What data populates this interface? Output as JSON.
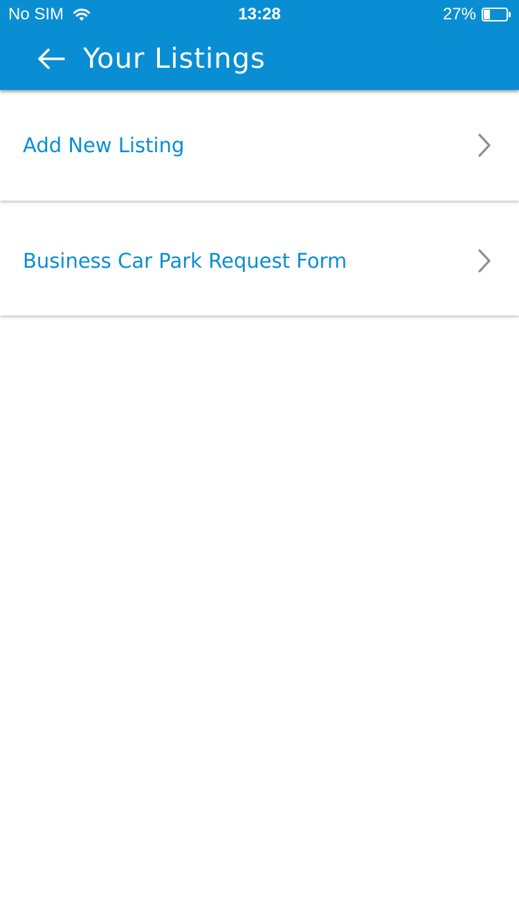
{
  "status_bar": {
    "carrier": "No SIM",
    "time": "13:28",
    "battery_percent": "27%",
    "battery_level": 0.27,
    "wifi_icon": "wifi-icon",
    "battery_icon": "battery-icon"
  },
  "header": {
    "title": "Your Listings",
    "back_icon": "arrow-left-icon",
    "background_color": "#0a8ed3"
  },
  "list": {
    "items": [
      {
        "label": "Add New Listing",
        "icon": "chevron-right-icon"
      },
      {
        "label": "Business Car Park Request Form",
        "icon": "chevron-right-icon"
      }
    ],
    "label_color": "#0a8ed3"
  }
}
